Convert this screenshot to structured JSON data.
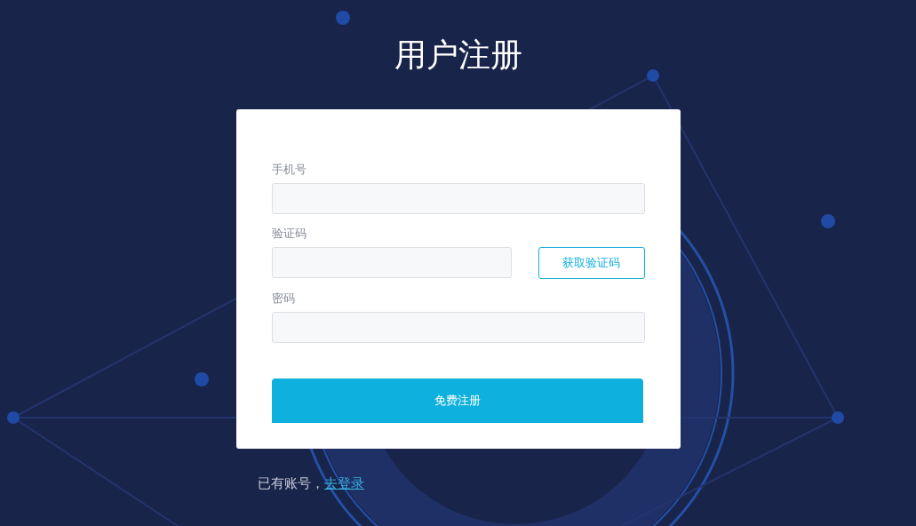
{
  "title": "用户注册",
  "form": {
    "fields": [
      {
        "label": "手机号",
        "kind": "input"
      },
      {
        "label": "验证码",
        "kind": "code",
        "button": "获取验证码"
      },
      {
        "label": "密码",
        "kind": "input"
      }
    ],
    "submit": "免费注册"
  },
  "footer": {
    "text": "已有账号，",
    "link": "去登录"
  }
}
